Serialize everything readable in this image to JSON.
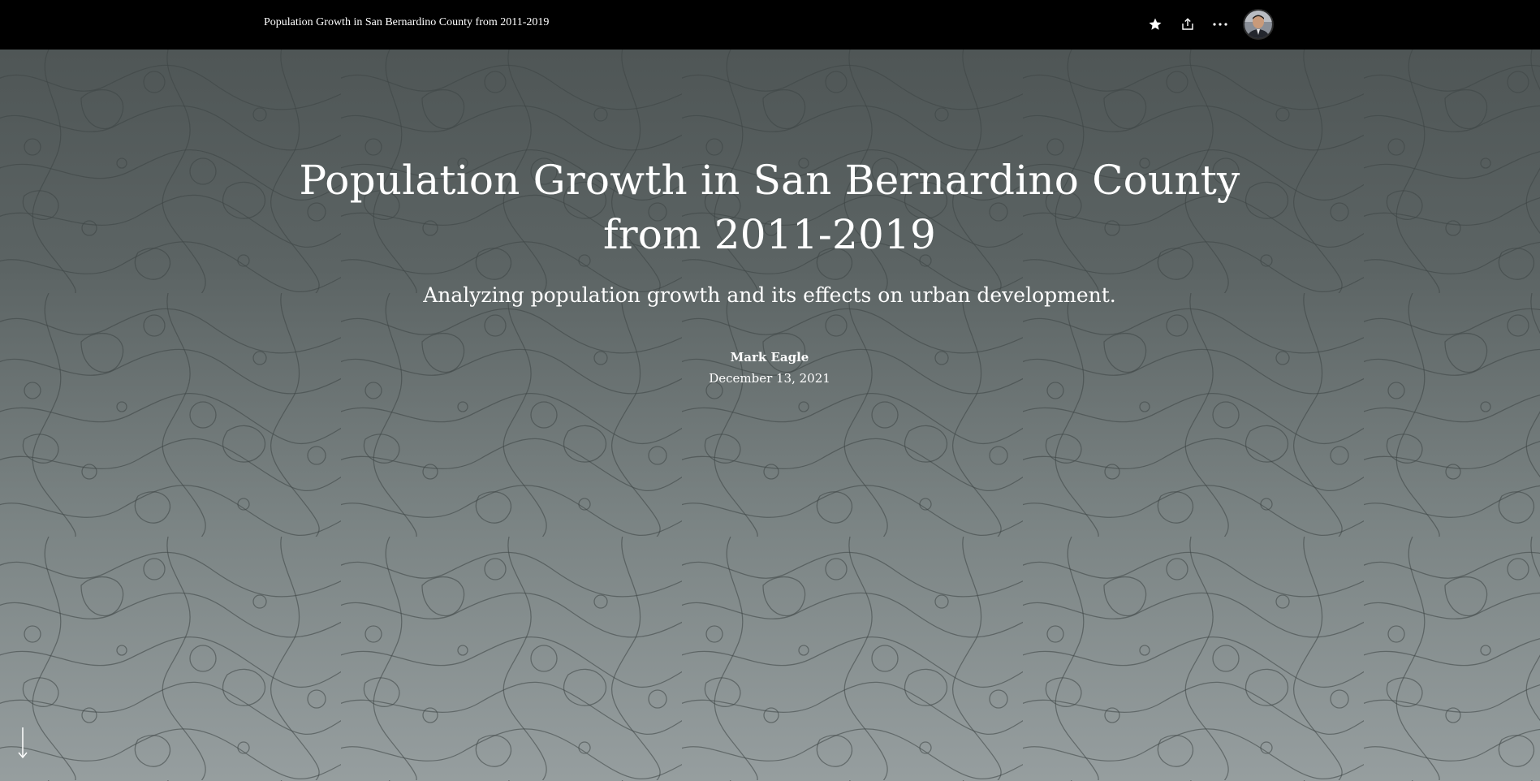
{
  "topbar": {
    "title": "Population Growth in San Bernardino County from 2011-2019",
    "actions": {
      "favorite_icon": "star-icon",
      "share_icon": "share-icon",
      "more_icon": "more-options-icon",
      "avatar_icon": "user-avatar"
    }
  },
  "hero": {
    "title_line1": "Population Growth in San Bernardino County",
    "title_line2": "from 2011-2019",
    "subtitle": "Analyzing population growth and its effects on urban development.",
    "author": "Mark Eagle",
    "date": "December 13, 2021",
    "scroll_icon": "arrow-down-icon"
  },
  "colors": {
    "topbar_bg": "#000000",
    "hero_top": "#4f5656",
    "hero_bottom": "#969e9f",
    "text": "#ffffff"
  }
}
